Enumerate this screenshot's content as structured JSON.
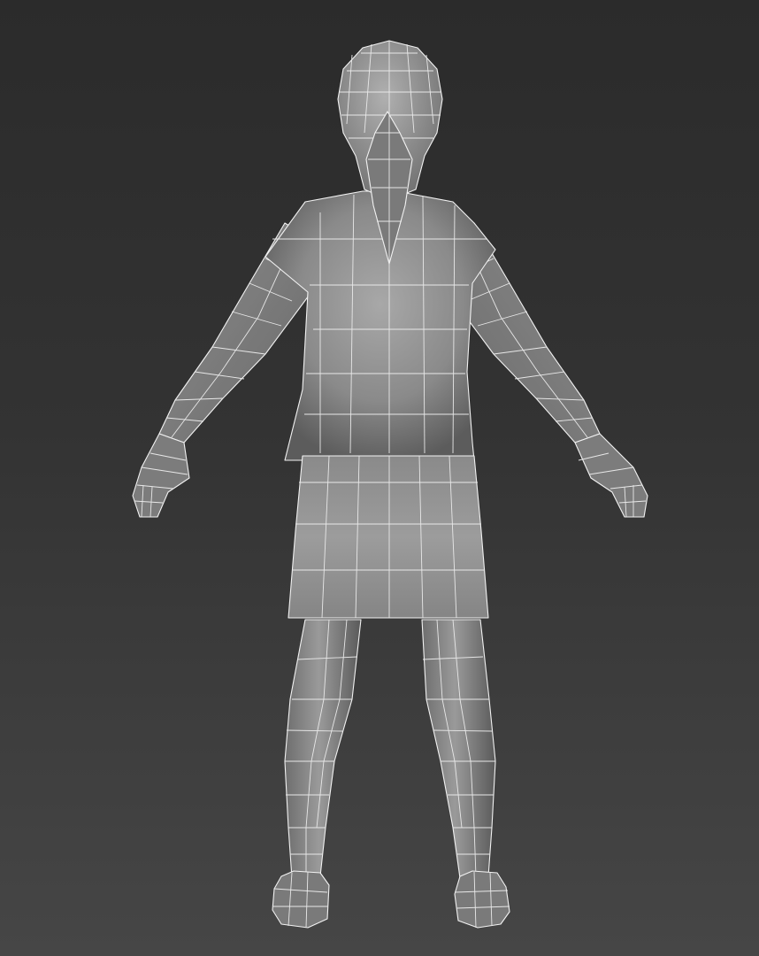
{
  "viewport": {
    "background_top": "#2b2b2b",
    "background_bottom": "#464646",
    "mesh_light": "#a2a2a2",
    "mesh_mid": "#808080",
    "mesh_dark": "#4a4a4a",
    "wire_color": "#f2f2f2"
  },
  "model": {
    "view": "back",
    "shading": "smooth-with-wireframe-overlay"
  }
}
